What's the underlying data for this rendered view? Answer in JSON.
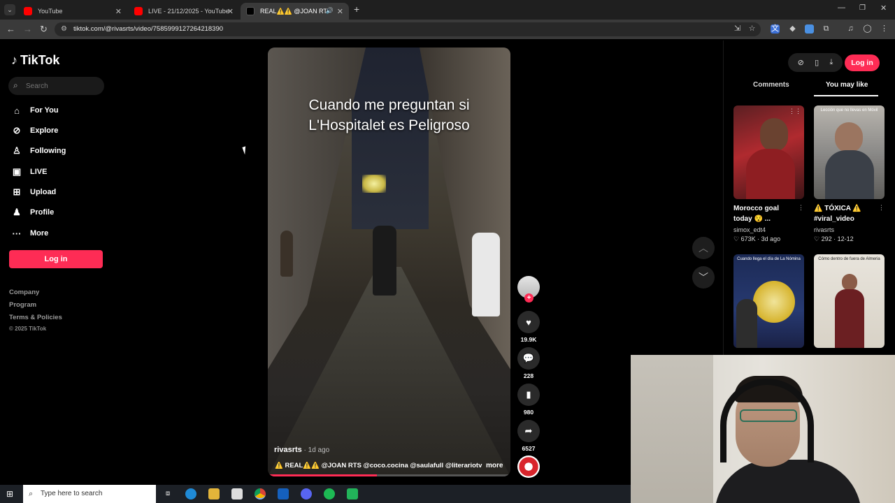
{
  "browser": {
    "tabs": [
      {
        "label": "YouTube",
        "color": "#ff0000",
        "active": false
      },
      {
        "label": "LIVE - 21/12/2025 - YouTube",
        "color": "#ff0000",
        "active": false
      },
      {
        "label": "REAL⚠️⚠️ @JOAN RTS @",
        "color": "#000000",
        "active": true
      }
    ],
    "new_tab_label": "+",
    "url": "tiktok.com/@rivasrts/video/7585999127264218390"
  },
  "sidebar": {
    "logo": "TikTok",
    "search_placeholder": "Search",
    "nav": [
      {
        "label": "For You",
        "icon": "home-icon"
      },
      {
        "label": "Explore",
        "icon": "compass-icon"
      },
      {
        "label": "Following",
        "icon": "following-icon"
      },
      {
        "label": "LIVE",
        "icon": "live-icon"
      },
      {
        "label": "Upload",
        "icon": "upload-icon"
      },
      {
        "label": "Profile",
        "icon": "profile-icon"
      },
      {
        "label": "More",
        "icon": "more-icon"
      }
    ],
    "login_label": "Log in",
    "footer_links": [
      "Company",
      "Program",
      "Terms & Policies"
    ],
    "copyright": "© 2025 TikTok"
  },
  "video": {
    "caption_line1": "Cuando me preguntan si",
    "caption_line2": "L'Hospitalet es Peligroso",
    "author": "rivasrts",
    "time": " · 1d ago",
    "description": "⚠️ REAL⚠️⚠️ @JOAN RTS @coco.cocina @saulafull @literariotv @...",
    "more_label": "more",
    "progress": 0.45
  },
  "actions": {
    "likes": "19.9K",
    "comments": "228",
    "saves": "980",
    "shares": "6527"
  },
  "right_panel": {
    "login_label": "Log in",
    "tabs": [
      "Comments",
      "You may like"
    ],
    "active_tab": "You may like",
    "cards": [
      {
        "title": "Morocco goal today 😯 ...",
        "author": "simox_edt4",
        "likes": "673K",
        "date": "3d ago",
        "overlay": ""
      },
      {
        "title": "⚠️ TÓXICA ⚠️ #viral_video #rivasrts...",
        "author": "rivasrts",
        "likes": "292",
        "date": "12-12",
        "overlay": "Lección que no llevas en Móvil"
      },
      {
        "title": "",
        "author": "",
        "likes": "",
        "date": "",
        "overlay": "Cuando llega el día de La Nómina"
      },
      {
        "title": "",
        "author": "",
        "likes": "",
        "date": "",
        "overlay": "Cómo dentro de fuera de Almeria"
      }
    ]
  },
  "taskbar": {
    "search_placeholder": "Type here to search"
  },
  "colors": {
    "accent": "#fe2c55",
    "background": "#000000"
  }
}
